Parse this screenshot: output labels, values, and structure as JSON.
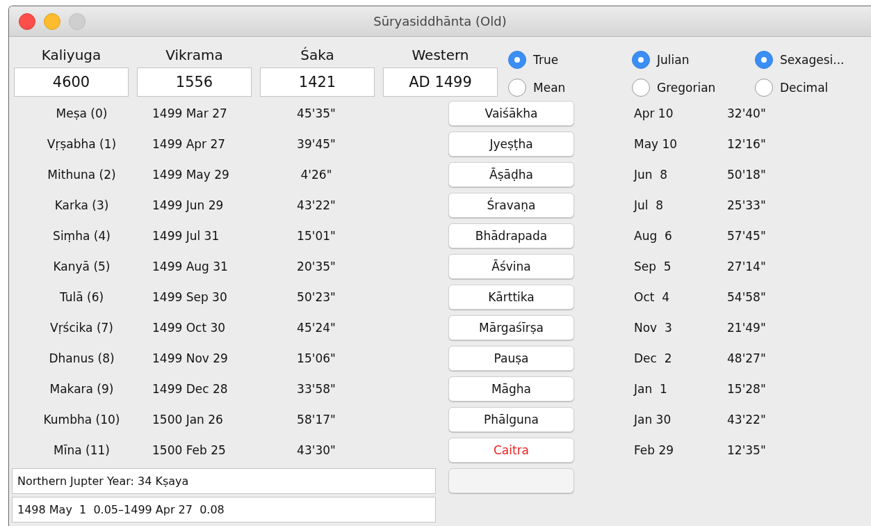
{
  "window": {
    "title": "Sūryasiddhānta (Old)"
  },
  "years": [
    {
      "label": "Kaliyuga",
      "value": "4600"
    },
    {
      "label": "Vikrama",
      "value": "1556"
    },
    {
      "label": "Śaka",
      "value": "1421"
    },
    {
      "label": "Western",
      "value": "AD 1499"
    }
  ],
  "radio_groups": [
    [
      {
        "label": "True",
        "selected": true
      },
      {
        "label": "Mean",
        "selected": false
      }
    ],
    [
      {
        "label": "Julian",
        "selected": true
      },
      {
        "label": "Gregorian",
        "selected": false
      }
    ],
    [
      {
        "label": "Sexagesi...",
        "selected": true
      },
      {
        "label": "Decimal",
        "selected": false
      }
    ]
  ],
  "rows": [
    {
      "sign": "Meṣa (0)",
      "date": "1499 Mar 27",
      "angle": "45'35\"",
      "month": "Vaiśākha",
      "highlighted": false,
      "month_date": "Apr 10",
      "month_angle": "32'40\""
    },
    {
      "sign": "Vṛṣabha (1)",
      "date": "1499 Apr 27",
      "angle": "39'45\"",
      "month": "Jyeṣṭha",
      "highlighted": false,
      "month_date": "May 10",
      "month_angle": "12'16\""
    },
    {
      "sign": "Mithuna (2)",
      "date": "1499 May 29",
      "angle": "4'26\"",
      "month": "Āṣāḍha",
      "highlighted": false,
      "month_date": "Jun  8",
      "month_angle": "50'18\""
    },
    {
      "sign": "Karka (3)",
      "date": "1499 Jun 29",
      "angle": "43'22\"",
      "month": "Śravaṇa",
      "highlighted": false,
      "month_date": "Jul  8",
      "month_angle": "25'33\""
    },
    {
      "sign": "Siṃha (4)",
      "date": "1499 Jul 31",
      "angle": "15'01\"",
      "month": "Bhādrapada",
      "highlighted": false,
      "month_date": "Aug  6",
      "month_angle": "57'45\""
    },
    {
      "sign": "Kanyā (5)",
      "date": "1499 Aug 31",
      "angle": "20'35\"",
      "month": "Āśvina",
      "highlighted": false,
      "month_date": "Sep  5",
      "month_angle": "27'14\""
    },
    {
      "sign": "Tulā (6)",
      "date": "1499 Sep 30",
      "angle": "50'23\"",
      "month": "Kārttika",
      "highlighted": false,
      "month_date": "Oct  4",
      "month_angle": "54'58\""
    },
    {
      "sign": "Vṛścika (7)",
      "date": "1499 Oct 30",
      "angle": "45'24\"",
      "month": "Mārgaśīrṣa",
      "highlighted": false,
      "month_date": "Nov  3",
      "month_angle": "21'49\""
    },
    {
      "sign": "Dhanus (8)",
      "date": "1499 Nov 29",
      "angle": "15'06\"",
      "month": "Pauṣa",
      "highlighted": false,
      "month_date": "Dec  2",
      "month_angle": "48'27\""
    },
    {
      "sign": "Makara (9)",
      "date": "1499 Dec 28",
      "angle": "33'58\"",
      "month": "Māgha",
      "highlighted": false,
      "month_date": "Jan  1",
      "month_angle": "15'28\""
    },
    {
      "sign": "Kumbha (10)",
      "date": "1500 Jan 26",
      "angle": "58'17\"",
      "month": "Phālguna",
      "highlighted": false,
      "month_date": "Jan 30",
      "month_angle": "43'22\""
    },
    {
      "sign": "Mīna (11)",
      "date": "1500 Feb 25",
      "angle": "43'30\"",
      "month": "Caitra",
      "highlighted": true,
      "month_date": "Feb 29",
      "month_angle": "12'35\""
    }
  ],
  "info_fields": [
    "Northern Jupter Year: 34 Kṣaya",
    "1498 May  1  0.05–1499 Apr 27  0.08"
  ]
}
